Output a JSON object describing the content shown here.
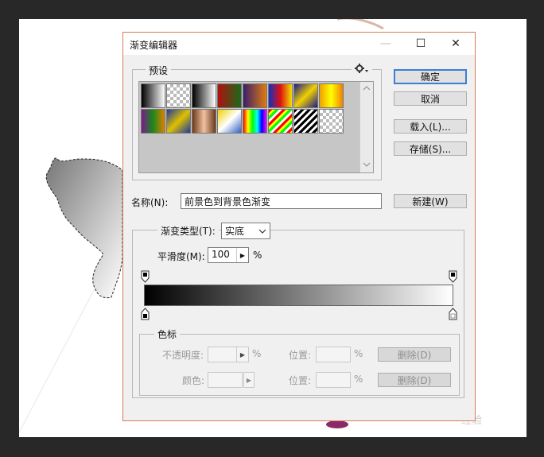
{
  "dialog": {
    "title": "渐变编辑器",
    "window_controls": {
      "minimize": "—",
      "maximize": "☐",
      "close": "✕"
    }
  },
  "presets": {
    "label": "预设",
    "menu_icon": "gear-icon",
    "swatches": [
      "linear-gradient(to right,#000,#fff)",
      "repeating-conic-gradient(#bbb 0 25%,#fff 0 50%) 0 0/8px 8px",
      "linear-gradient(to right,#000,#fff)",
      "linear-gradient(to right,#b01010,#1a6a1a)",
      "linear-gradient(to right,#3a1f6a,#e07a10)",
      "linear-gradient(to right,#1030c0,#e01010,#f0e000)",
      "linear-gradient(135deg,#1a1a8a,#f0d000,#1a1a8a)",
      "linear-gradient(to right,#f0a000,#ff0,#f08000)",
      "linear-gradient(to right,#7a1a8a,#1a8a1a,#e08000)",
      "linear-gradient(135deg,#1a3aa0,#e0c000,#1a3aa0)",
      "linear-gradient(to right,#6a3a1a,#f0c0a0,#6a3a1a)",
      "linear-gradient(135deg,#f0d000,#fff,#3060c0)",
      "linear-gradient(to right,#f00,#ff0,#0f0,#0ff,#00f,#f0f)",
      "repeating-linear-gradient(135deg,#f00 0 3px,#ff0 3px 6px,#0f0 6px 9px,#fff 9px 12px)",
      "repeating-linear-gradient(135deg,#000 0 3px,#fff 3px 6px)",
      "repeating-conic-gradient(#bbb 0 25%,#fff 0 50%) 0 0/8px 8px"
    ]
  },
  "buttons": {
    "ok": "确定",
    "cancel": "取消",
    "load": "载入(L)...",
    "save": "存储(S)...",
    "new": "新建(W)"
  },
  "name": {
    "label": "名称(N):",
    "value": "前景色到背景色渐变"
  },
  "gradient_type": {
    "label": "渐变类型(T):",
    "value": "实底"
  },
  "smoothness": {
    "label": "平滑度(M):",
    "value": "100",
    "unit": "%"
  },
  "gradient": {
    "start_color": "#000000",
    "end_color": "#ffffff"
  },
  "color_stops": {
    "label": "色标",
    "opacity_label": "不透明度:",
    "percent": "%",
    "location_label": "位置:",
    "color_label": "颜色:",
    "delete_label": "删除(D)"
  },
  "watermark": "经验"
}
